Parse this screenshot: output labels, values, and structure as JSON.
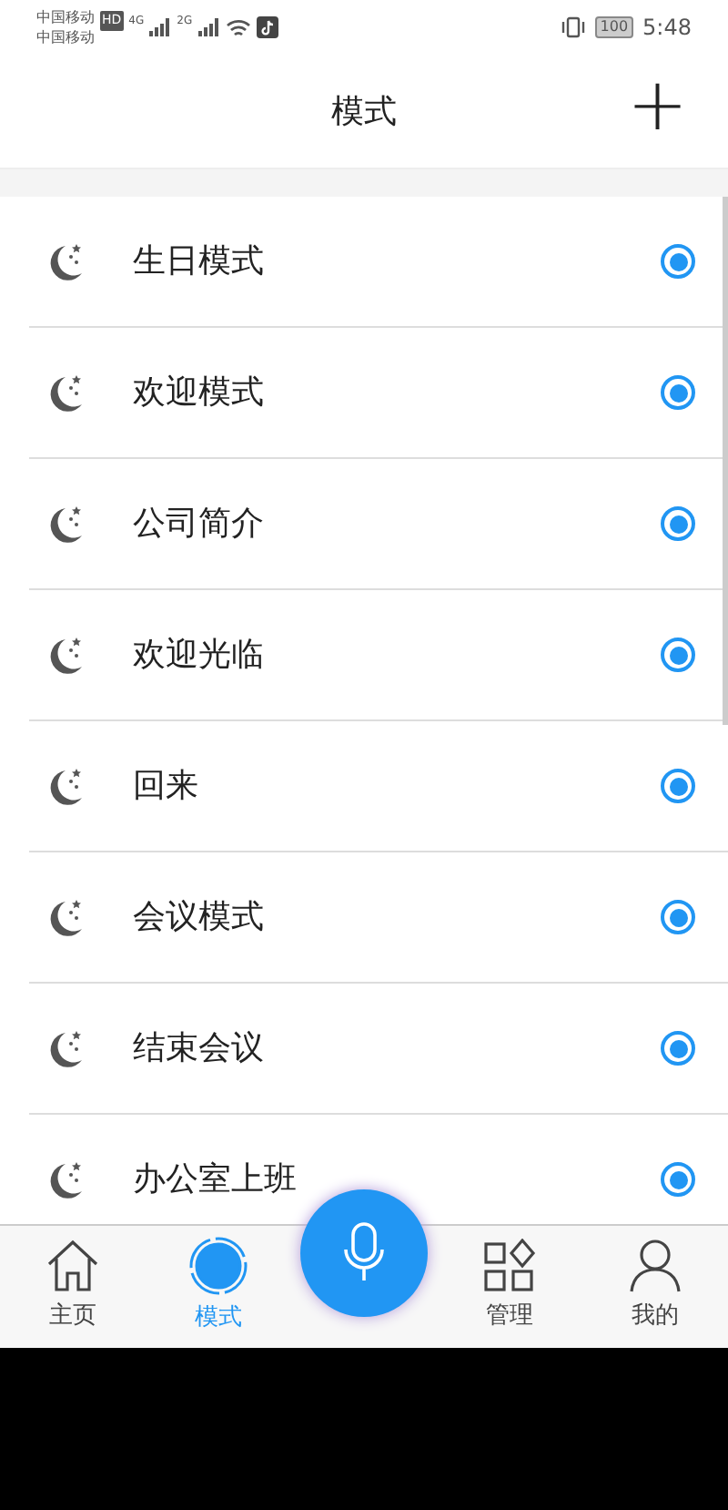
{
  "status_bar": {
    "carrier_1": "中国移动",
    "carrier_2": "中国移动",
    "hd": "HD",
    "net_1": "4G",
    "net_2": "2G",
    "battery": "100",
    "time": "5:48"
  },
  "header": {
    "title": "模式",
    "add": "+"
  },
  "modes": [
    {
      "label": "生日模式",
      "active": true
    },
    {
      "label": "欢迎模式",
      "active": true
    },
    {
      "label": "公司简介",
      "active": true
    },
    {
      "label": "欢迎光临",
      "active": true
    },
    {
      "label": "回来",
      "active": true
    },
    {
      "label": "会议模式",
      "active": true
    },
    {
      "label": "结束会议",
      "active": true
    },
    {
      "label": "办公室上班",
      "active": true
    }
  ],
  "nav": [
    {
      "kind": "home",
      "label": "主页",
      "selected": false
    },
    {
      "kind": "mode",
      "label": "模式",
      "selected": true
    },
    {
      "kind": "mic"
    },
    {
      "kind": "manage",
      "label": "管理",
      "selected": false
    },
    {
      "kind": "mine",
      "label": "我的",
      "selected": false
    }
  ]
}
